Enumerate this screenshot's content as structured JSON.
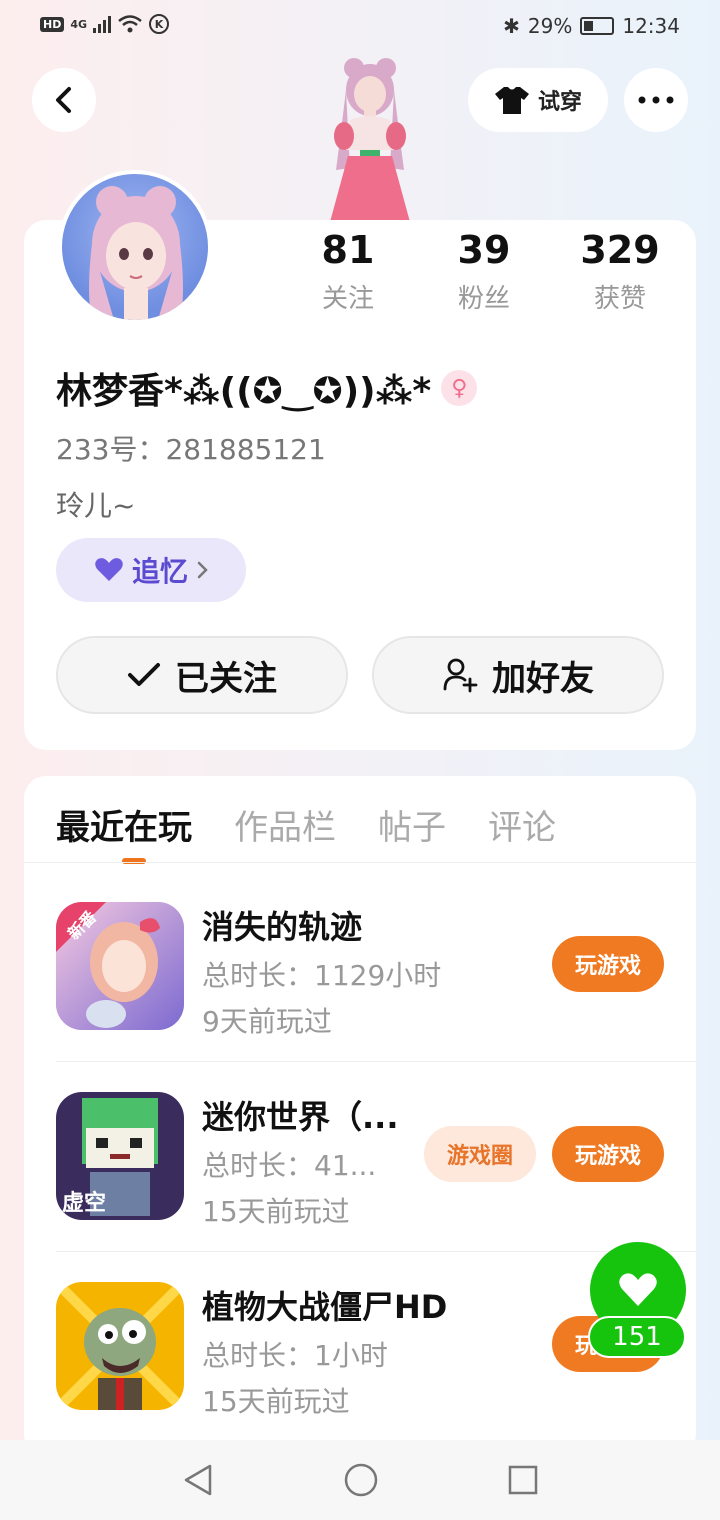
{
  "status_bar": {
    "network": "4G",
    "battery": "29%",
    "time": "12:34",
    "hd_label": "HD"
  },
  "header": {
    "tryon_label": "试穿"
  },
  "profile": {
    "stats": [
      {
        "value": "81",
        "label": "关注"
      },
      {
        "value": "39",
        "label": "粉丝"
      },
      {
        "value": "329",
        "label": "获赞"
      }
    ],
    "nickname": "林梦香*⁂((✪‿✪))⁂*",
    "uid": "233号：281885121",
    "bio": "玲儿~",
    "tag": "追忆",
    "followed_label": "已关注",
    "add_friend_label": "加好友"
  },
  "tabs": [
    "最近在玩",
    "作品栏",
    "帖子",
    "评论"
  ],
  "games": [
    {
      "title": "消失的轨迹",
      "duration": "总时长：1129小时",
      "last_played": "9天前玩过",
      "play_label": "玩游戏",
      "badge": "新番"
    },
    {
      "title": "迷你世界（...",
      "duration": "总时长：41...",
      "last_played": "15天前玩过",
      "play_label": "玩游戏",
      "circle_label": "游戏圈",
      "badge": "虚空"
    },
    {
      "title": "植物大战僵尸HD",
      "duration": "总时长：1小时",
      "last_played": "15天前玩过",
      "play_label": "玩游戏"
    }
  ],
  "like": {
    "count": "151"
  },
  "colors": {
    "accent": "#f07a22",
    "like_green": "#16c40e",
    "tag_purple": "#5b4bd0"
  }
}
